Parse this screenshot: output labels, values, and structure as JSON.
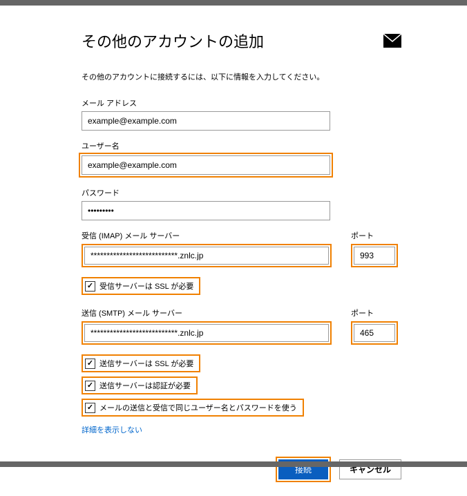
{
  "header": {
    "title": "その他のアカウントの追加"
  },
  "subtitle": "その他のアカウントに接続するには、以下に情報を入力してください。",
  "fields": {
    "email_label": "メール アドレス",
    "email_value": "example@example.com",
    "username_label": "ユーザー名",
    "username_value": "example@example.com",
    "password_label": "パスワード",
    "password_value": "•••••••••",
    "imap_label": "受信 (IMAP) メール サーバー",
    "imap_value": "***************************.znlc.jp",
    "imap_port_label": "ポート",
    "imap_port_value": "993",
    "smtp_label": "送信 (SMTP) メール サーバー",
    "smtp_value": "***************************.znlc.jp",
    "smtp_port_label": "ポート",
    "smtp_port_value": "465"
  },
  "checkboxes": {
    "incoming_ssl": "受信サーバーは SSL が必要",
    "outgoing_ssl": "送信サーバーは SSL が必要",
    "outgoing_auth": "送信サーバーは認証が必要",
    "same_credentials": "メールの送信と受信で同じユーザー名とパスワードを使う"
  },
  "link_hide_details": "詳細を表示しない",
  "buttons": {
    "connect": "接続",
    "cancel": "キャンセル"
  }
}
